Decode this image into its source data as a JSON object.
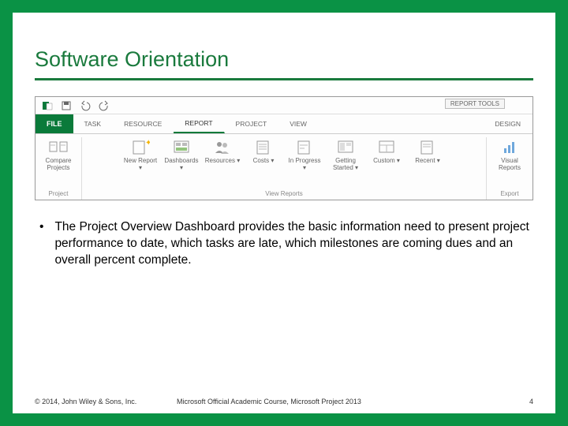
{
  "title": "Software Orientation",
  "quickAccess": {
    "appIcon": "project-app-icon",
    "icons": [
      "save-icon",
      "undo-icon",
      "redo-icon"
    ]
  },
  "reportTools": "REPORT TOOLS",
  "tabs": {
    "file": "FILE",
    "items": [
      {
        "label": "TASK",
        "active": false
      },
      {
        "label": "RESOURCE",
        "active": false
      },
      {
        "label": "REPORT",
        "active": true
      },
      {
        "label": "PROJECT",
        "active": false
      },
      {
        "label": "VIEW",
        "active": false
      }
    ],
    "design": "DESIGN"
  },
  "ribbonGroups": {
    "project": {
      "label": "Project",
      "buttons": [
        {
          "label": "Compare Projects",
          "icon": "compare-icon"
        }
      ]
    },
    "viewReports": {
      "label": "View Reports",
      "buttons": [
        {
          "label": "New Report",
          "icon": "new-report-icon",
          "dropdown": true
        },
        {
          "label": "Dashboards",
          "icon": "dashboards-icon",
          "dropdown": true
        },
        {
          "label": "Resources",
          "icon": "resources-icon",
          "dropdown": true
        },
        {
          "label": "Costs",
          "icon": "costs-icon",
          "dropdown": true
        },
        {
          "label": "In Progress",
          "icon": "progress-icon",
          "dropdown": true
        },
        {
          "label": "Getting Started",
          "icon": "started-icon",
          "dropdown": true
        },
        {
          "label": "Custom",
          "icon": "custom-icon",
          "dropdown": true
        },
        {
          "label": "Recent",
          "icon": "recent-icon",
          "dropdown": true
        }
      ]
    },
    "export": {
      "label": "Export",
      "buttons": [
        {
          "label": "Visual Reports",
          "icon": "visual-reports-icon"
        }
      ]
    }
  },
  "bullet": "The Project Overview Dashboard provides the basic information need to present project performance to date, which tasks are late, which milestones are coming dues and an overall percent complete.",
  "footer": {
    "left": "© 2014, John Wiley & Sons, Inc.",
    "center": "Microsoft Official Academic Course, Microsoft Project 2013",
    "pageNumber": "4"
  }
}
